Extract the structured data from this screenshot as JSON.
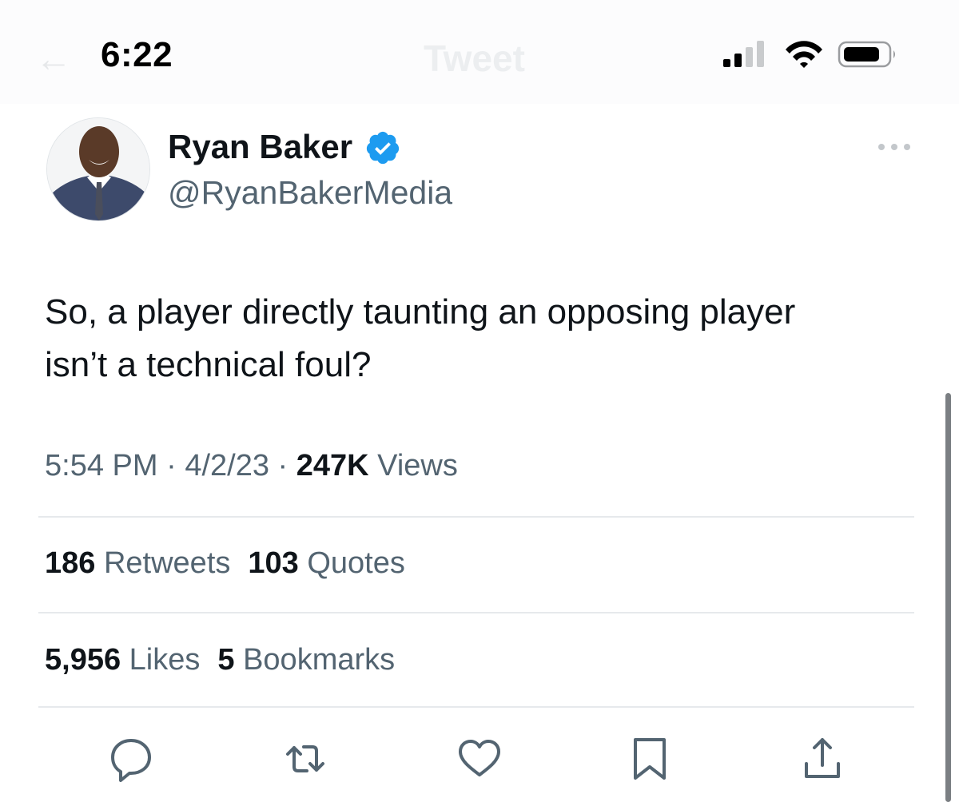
{
  "status_bar": {
    "time": "6:22",
    "faded_back": "←",
    "faded_title": "Tweet",
    "icons": [
      "cellular-signal-icon",
      "wifi-icon",
      "battery-icon"
    ]
  },
  "tweet": {
    "author": {
      "name": "Ryan Baker",
      "handle": "@RyanBakerMedia",
      "verified": true
    },
    "text_line1": "So, a player directly taunting an opposing player",
    "text_line2": "isn’t a technical foul?",
    "time": "5:54 PM",
    "date": "4/2/23",
    "sep": "·",
    "views_count": "247K",
    "views_label": "Views",
    "retweets_count": "186",
    "retweets_label": "Retweets",
    "quotes_count": "103",
    "quotes_label": "Quotes",
    "likes_count": "5,956",
    "likes_label": "Likes",
    "bookmarks_count": "5",
    "bookmarks_label": "Bookmarks"
  },
  "actions": [
    "reply-icon",
    "retweet-icon",
    "like-icon",
    "bookmark-icon",
    "share-icon"
  ],
  "colors": {
    "text_primary": "#0f1419",
    "text_secondary": "#536471",
    "verified_blue": "#1d9bf0",
    "divider": "#e6e9ec"
  }
}
